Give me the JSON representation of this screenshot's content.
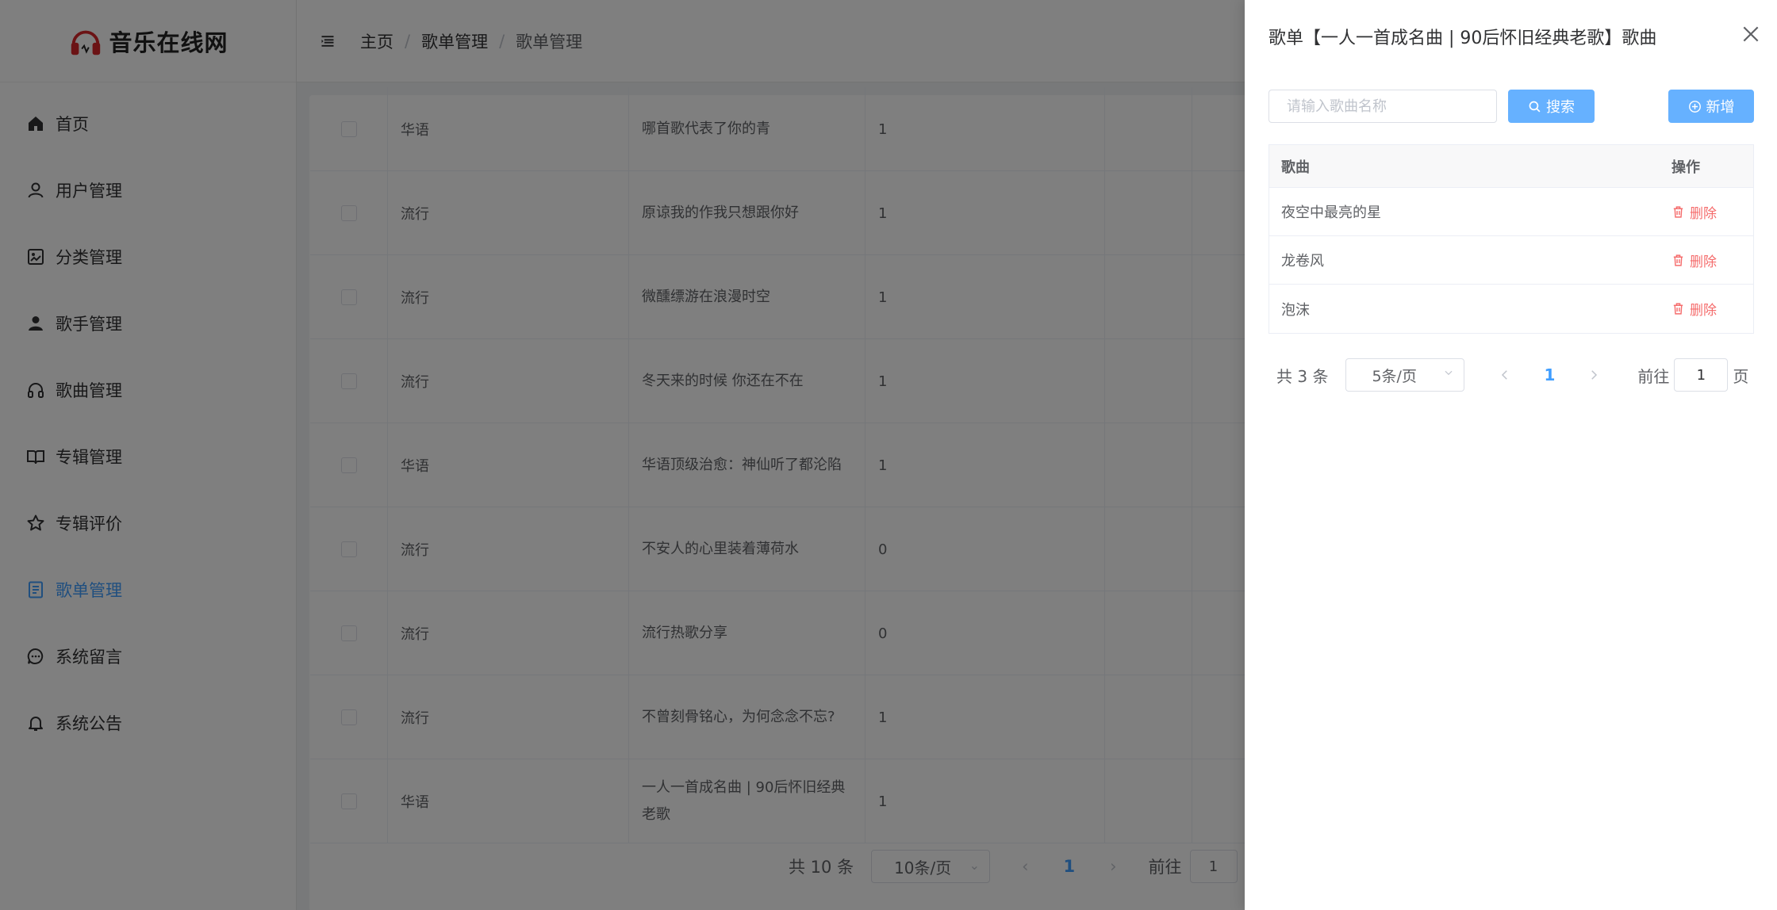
{
  "app": {
    "logo_text": "音乐在线网"
  },
  "sidebar": {
    "items": [
      {
        "label": "首页",
        "icon": "home-icon",
        "active": false
      },
      {
        "label": "用户管理",
        "icon": "user-icon",
        "active": false
      },
      {
        "label": "分类管理",
        "icon": "category-icon",
        "active": false
      },
      {
        "label": "歌手管理",
        "icon": "singer-icon",
        "active": false
      },
      {
        "label": "歌曲管理",
        "icon": "headphones-icon",
        "active": false
      },
      {
        "label": "专辑管理",
        "icon": "book-icon",
        "active": false
      },
      {
        "label": "专辑评价",
        "icon": "star-icon",
        "active": false
      },
      {
        "label": "歌单管理",
        "icon": "document-icon",
        "active": true
      },
      {
        "label": "系统留言",
        "icon": "chat-icon",
        "active": false
      },
      {
        "label": "系统公告",
        "icon": "bell-icon",
        "active": false
      }
    ]
  },
  "header": {
    "breadcrumb": [
      "主页",
      "歌单管理",
      "歌单管理"
    ],
    "separator": "/"
  },
  "playlist_table": {
    "rows": [
      {
        "category": "华语",
        "name": "哪首歌代表了你的青",
        "count": "1",
        "cover_color": "#5a4a44"
      },
      {
        "category": "流行",
        "name": "原谅我的作我只想跟你好",
        "count": "1",
        "cover_color": "#b08a7a"
      },
      {
        "category": "流行",
        "name": "微醺缥游在浪漫时空",
        "count": "1",
        "cover_color": "#8a6a4e"
      },
      {
        "category": "流行",
        "name": "冬天来的时候 你还在不在",
        "count": "1",
        "cover_color": "#3a3232"
      },
      {
        "category": "华语",
        "name": "华语顶级治愈：神仙听了都沦陷",
        "count": "1",
        "cover_color": "#9a2430"
      },
      {
        "category": "流行",
        "name": "不安人的心里装着薄荷水",
        "count": "0",
        "cover_color": "#8fa0b4"
      },
      {
        "category": "流行",
        "name": "流行热歌分享",
        "count": "0",
        "cover_color": "#7a5a5a"
      },
      {
        "category": "流行",
        "name": "不曾刻骨铭心，为何念念不忘?",
        "count": "1",
        "cover_color": "#a7b2bd"
      },
      {
        "category": "华语",
        "name": "一人一首成名曲 | 90后怀旧经典老歌",
        "count": "1",
        "cover_color": "#4a3a34"
      }
    ]
  },
  "main_pager": {
    "total": "共 10 条",
    "page_size": "10条/页",
    "current_page": "1",
    "goto_label": "前往",
    "goto_value": "1"
  },
  "drawer": {
    "title": "歌单【一人一首成名曲 | 90后怀旧经典老歌】歌曲",
    "search_placeholder": "请输入歌曲名称",
    "search_label": "搜索",
    "add_label": "新增",
    "table": {
      "col_song": "歌曲",
      "col_action": "操作",
      "rows": [
        {
          "song": "夜空中最亮的星",
          "action": "删除"
        },
        {
          "song": "龙卷风",
          "action": "删除"
        },
        {
          "song": "泡沫",
          "action": "删除"
        }
      ]
    },
    "pager": {
      "total": "共 3 条",
      "page_size": "5条/页",
      "current_page": "1",
      "goto_label": "前往",
      "goto_value": "1",
      "page_suffix": "页"
    }
  },
  "colors": {
    "primary": "#409eff",
    "button": "#66b1ff",
    "danger": "#f56c6c",
    "logo_red": "#d7262a"
  }
}
